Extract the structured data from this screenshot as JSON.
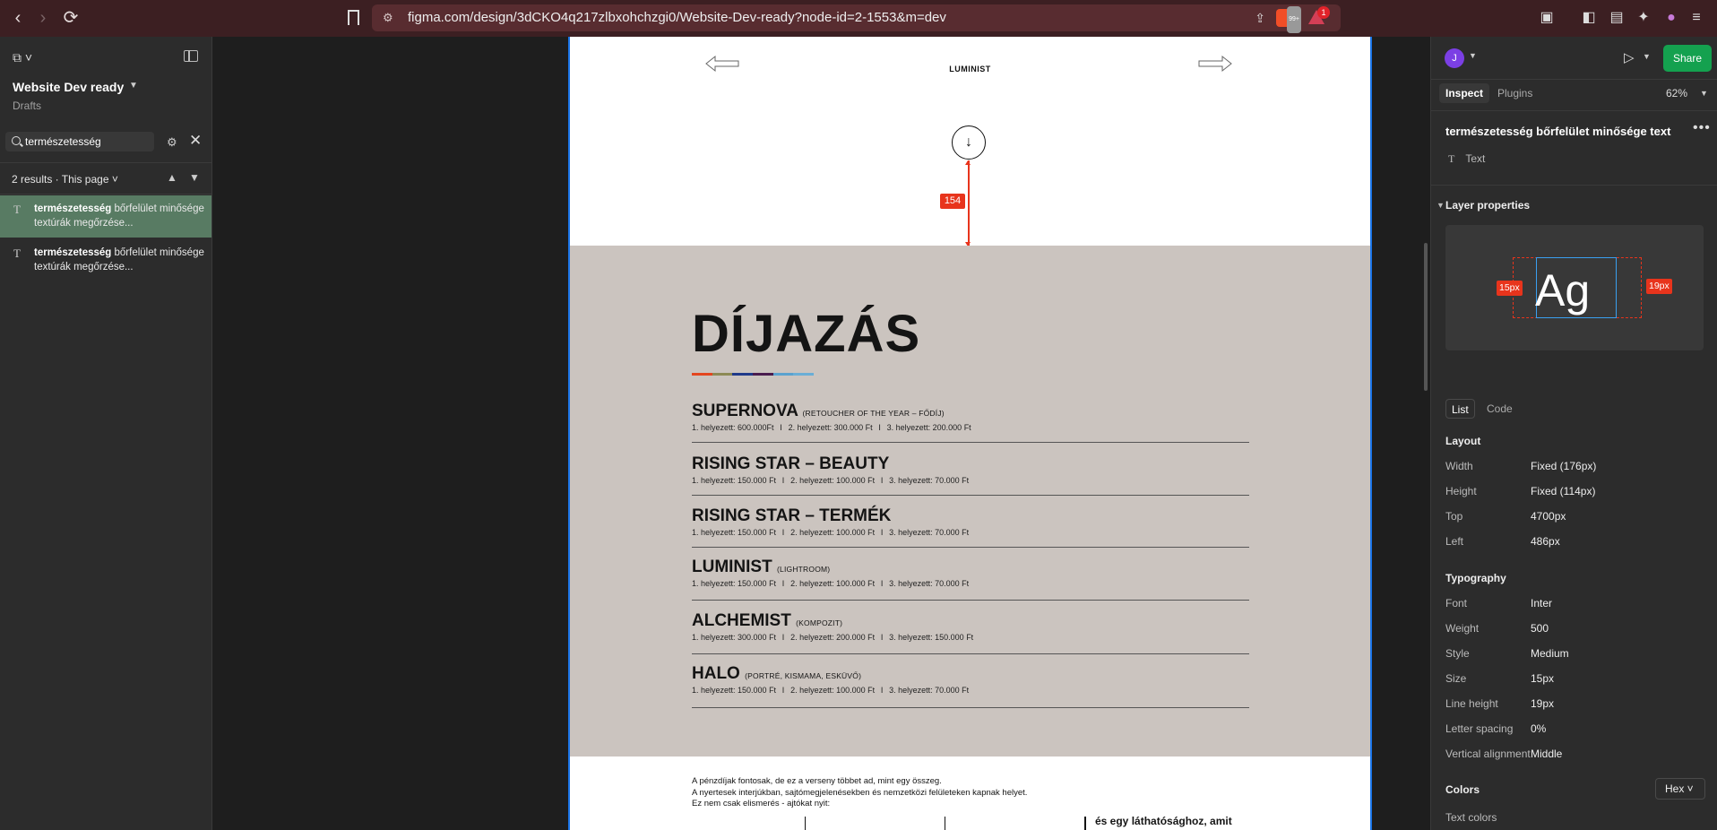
{
  "browser": {
    "url": "figma.com/design/3dCKO4q217zlbxohchzgi0/Website-Dev-ready?node-id=2-1553&m=dev",
    "brave_badge": "99+",
    "alert_badge": "1"
  },
  "left_panel": {
    "file_title": "Website Dev ready",
    "file_location": "Drafts",
    "search_value": "természetesség",
    "results_summary": "2 results · This page",
    "results": [
      {
        "match": "természetesség",
        "rest": " bőrfelület minősége textúrák megőrzése..."
      },
      {
        "match": "természetesség",
        "rest": " bőrfelület minősége textúrák megőrzése..."
      }
    ]
  },
  "canvas": {
    "brand": "LUMINIST",
    "measurement": "154",
    "section_title": "DÍJAZÁS",
    "underline_colors": [
      "#e4461f",
      "#8c8a55",
      "#1f3a8a",
      "#4a1c4e",
      "#5aa2cf",
      "#6aaed6"
    ],
    "prizes": [
      {
        "name": "SUPERNOVA",
        "sub": "(RETOUCHER OF THE YEAR – FŐDÍJ)",
        "p1": "1. helyezett: 600.000Ft",
        "p2": "2. helyezett: 300.000 Ft",
        "p3": "3. helyezett: 200.000 Ft"
      },
      {
        "name": "RISING STAR – BEAUTY",
        "sub": "",
        "p1": "1. helyezett: 150.000 Ft",
        "p2": "2. helyezett: 100.000 Ft",
        "p3": "3. helyezett: 70.000 Ft"
      },
      {
        "name": "RISING STAR – TERMÉK",
        "sub": "",
        "p1": "1. helyezett: 150.000 Ft",
        "p2": "2. helyezett: 100.000 Ft",
        "p3": "3. helyezett: 70.000 Ft"
      },
      {
        "name": "LUMINIST",
        "sub": "(LIGHTROOM)",
        "p1": "1. helyezett: 150.000 Ft",
        "p2": "2. helyezett: 100.000 Ft",
        "p3": "3. helyezett: 70.000 Ft"
      },
      {
        "name": "ALCHEMIST",
        "sub": "(KOMPOZIT)",
        "p1": "1. helyezett: 300.000 Ft",
        "p2": "2. helyezett: 200.000 Ft",
        "p3": "3. helyezett: 150.000 Ft"
      },
      {
        "name": "HALO",
        "sub": "(PORTRÉ, KISMAMA, ESKÜVŐ)",
        "p1": "1. helyezett: 150.000 Ft",
        "p2": "2. helyezett: 100.000 Ft",
        "p3": "3. helyezett: 70.000 Ft"
      }
    ],
    "separator": "I",
    "bottom_lines": [
      "A pénzdíjak fontosak, de ez a verseny többet ad, mint egy összeg.",
      "A nyertesek interjúkban, sajtómegjelenésekben és nemzetközi felületeken kapnak helyet.",
      "Ez nem csak elismerés - ajtókat nyit:"
    ],
    "bottom_bold": "és egy láthatósághoz, amit"
  },
  "right_panel": {
    "avatar_initial": "J",
    "share_label": "Share",
    "tabs": [
      "Inspect",
      "Plugins"
    ],
    "zoom": "62%",
    "layer_name": "természetesség bőrfelület minősége text",
    "layer_type": "Text",
    "section_layer": "Layer properties",
    "preview": {
      "glyph": "Ag",
      "left_label": "15px",
      "right_label": "19px"
    },
    "view_tabs": [
      "List",
      "Code"
    ],
    "layout_title": "Layout",
    "layout": [
      {
        "label": "Width",
        "value": "Fixed (176px)"
      },
      {
        "label": "Height",
        "value": "Fixed (114px)"
      },
      {
        "label": "Top",
        "value": "4700px"
      },
      {
        "label": "Left",
        "value": "486px"
      }
    ],
    "typography_title": "Typography",
    "typography": [
      {
        "label": "Font",
        "value": "Inter"
      },
      {
        "label": "Weight",
        "value": "500"
      },
      {
        "label": "Style",
        "value": "Medium"
      },
      {
        "label": "Size",
        "value": "15px"
      },
      {
        "label": "Line height",
        "value": "19px"
      },
      {
        "label": "Letter spacing",
        "value": "0%"
      },
      {
        "label": "Vertical alignment",
        "value": "Middle"
      }
    ],
    "colors_title": "Colors",
    "color_format": "Hex",
    "text_colors_title": "Text colors",
    "text_color": "#141414"
  }
}
